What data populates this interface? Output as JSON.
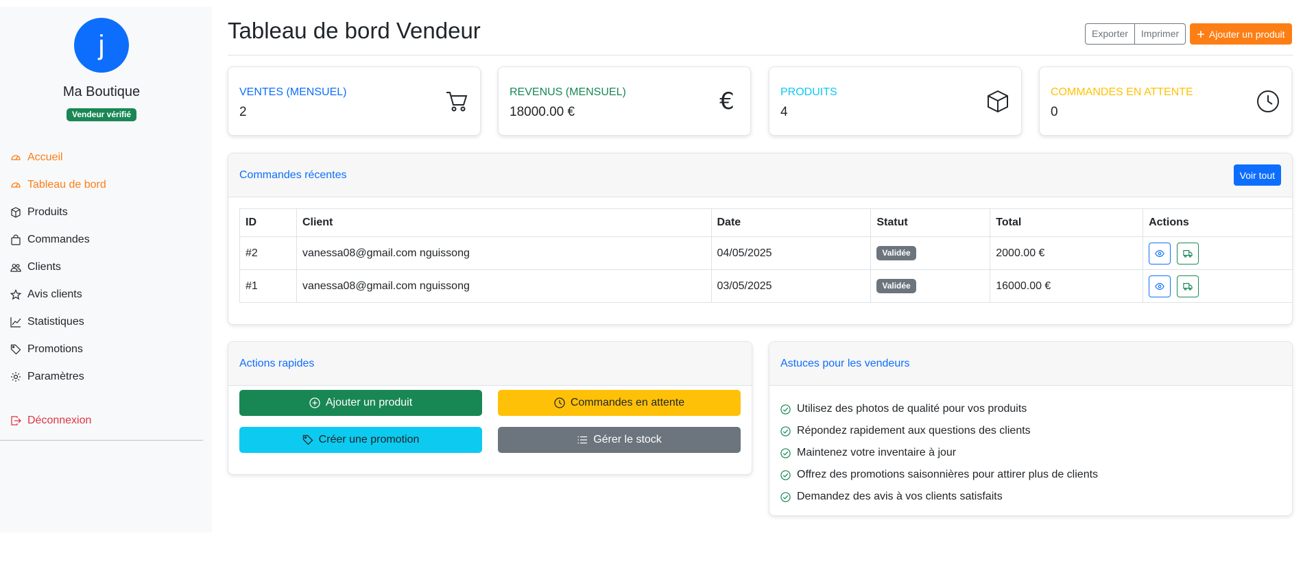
{
  "sidebar": {
    "avatar_letter": "j",
    "shop_name": "Ma Boutique",
    "badge": "Vendeur vérifié",
    "items": [
      {
        "label": "Accueil",
        "icon": "speedometer-icon",
        "active": true
      },
      {
        "label": "Tableau de bord",
        "icon": "speedometer-icon",
        "active": true
      },
      {
        "label": "Produits",
        "icon": "box-icon",
        "active": false
      },
      {
        "label": "Commandes",
        "icon": "bag-icon",
        "active": false
      },
      {
        "label": "Clients",
        "icon": "people-icon",
        "active": false
      },
      {
        "label": "Avis clients",
        "icon": "star-icon",
        "active": false
      },
      {
        "label": "Statistiques",
        "icon": "graph-icon",
        "active": false
      },
      {
        "label": "Promotions",
        "icon": "tags-icon",
        "active": false
      },
      {
        "label": "Paramètres",
        "icon": "gear-icon",
        "active": false
      }
    ],
    "logout": "Déconnexion"
  },
  "header": {
    "title": "Tableau de bord Vendeur",
    "export": "Exporter",
    "print": "Imprimer",
    "add_product": "Ajouter un produit"
  },
  "stats": [
    {
      "label": "VENTES (MENSUEL)",
      "value": "2",
      "color": "#0d6efd",
      "icon": "cart-icon"
    },
    {
      "label": "REVENUS (MENSUEL)",
      "value": "18000.00 €",
      "color": "#198754",
      "icon": "euro-icon"
    },
    {
      "label": "PRODUITS",
      "value": "4",
      "color": "#0dcaf0",
      "icon": "box-icon"
    },
    {
      "label": "COMMANDES EN ATTENTE",
      "value": "0",
      "color": "#ffc107",
      "icon": "clock-icon"
    }
  ],
  "orders": {
    "title": "Commandes récentes",
    "view_all": "Voir tout",
    "columns": [
      "ID",
      "Client",
      "Date",
      "Statut",
      "Total",
      "Actions"
    ],
    "rows": [
      {
        "id": "#2",
        "client": "vanessa08@gmail.com nguissong",
        "date": "04/05/2025",
        "status": "Validée",
        "total": "2000.00 €"
      },
      {
        "id": "#1",
        "client": "vanessa08@gmail.com nguissong",
        "date": "03/05/2025",
        "status": "Validée",
        "total": "16000.00 €"
      }
    ]
  },
  "quick_actions": {
    "title": "Actions rapides",
    "add_product": "Ajouter un produit",
    "pending_orders": "Commandes en attente",
    "create_promo": "Créer une promotion",
    "manage_stock": "Gérer le stock"
  },
  "tips": {
    "title": "Astuces pour les vendeurs",
    "items": [
      "Utilisez des photos de qualité pour vos produits",
      "Répondez rapidement aux questions des clients",
      "Maintenez votre inventaire à jour",
      "Offrez des promotions saisonnières pour attirer plus de clients",
      "Demandez des avis à vos clients satisfaits"
    ]
  },
  "colors": {
    "primary": "#0d6efd",
    "success": "#198754",
    "info": "#0dcaf0",
    "warning": "#ffc107",
    "secondary": "#6c757d",
    "accent": "#fd7e14",
    "danger": "#dc3545"
  }
}
